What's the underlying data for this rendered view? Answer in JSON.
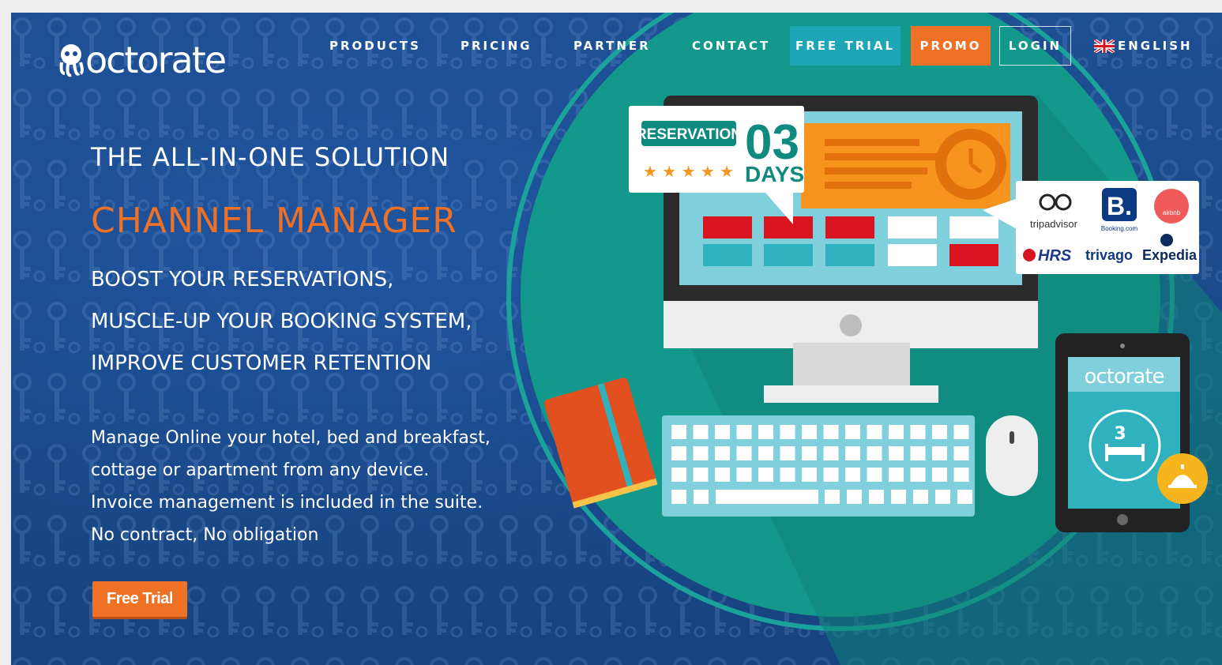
{
  "brand": {
    "logo_text": "octorate"
  },
  "nav": {
    "products": "PRODUCTS",
    "pricing": "PRICING",
    "partner": "PARTNER",
    "contact": "CONTACT",
    "free_trial": "FREE TRIAL",
    "promo": "PROMO",
    "login": "LOGIN",
    "language": "ENGLISH"
  },
  "hero": {
    "kicker": "THE ALL-IN-ONE SOLUTION",
    "title": "CHANNEL MANAGER",
    "bullets": [
      "BOOST YOUR RESERVATIONS,",
      "MUSCLE-UP YOUR BOOKING SYSTEM,",
      "IMPROVE CUSTOMER RETENTION"
    ],
    "description": [
      "Manage Online your hotel, bed and breakfast,",
      "cottage or apartment from any device.",
      "Invoice management is included in the suite.",
      "No contract, No obligation"
    ],
    "cta_label": "Free Trial"
  },
  "illustration": {
    "reservation_label": "RESERVATION",
    "days_number": "03",
    "days_label": "DAYS",
    "ota_logos": [
      "tripadvisor",
      "Booking.com",
      "airbnb",
      "HRS",
      "trivago",
      "Expedia"
    ],
    "tablet_logo": "octorate",
    "tablet_badge": "3"
  },
  "colors": {
    "background": "#1a4a8b",
    "accent_orange": "#ee7125",
    "accent_teal": "#1fa6b6",
    "circle_teal": "#13998c"
  }
}
